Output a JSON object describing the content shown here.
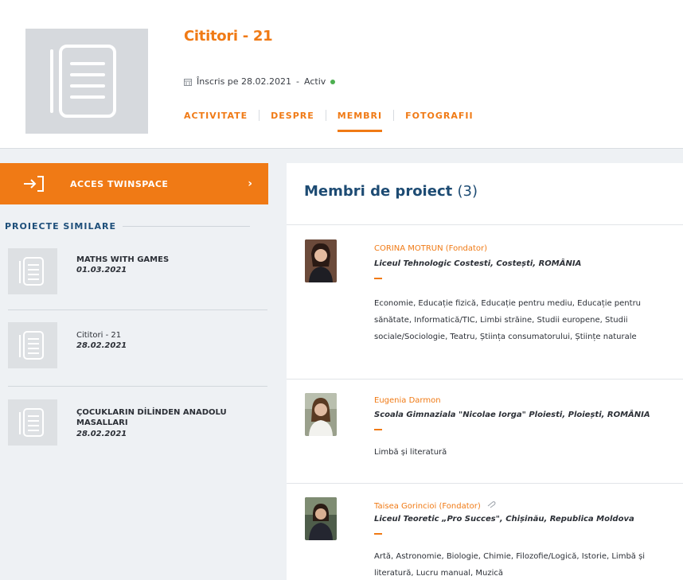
{
  "header": {
    "title": "Cititori - 21",
    "enrolled": "Înscris pe 28.02.2021",
    "separator": "-",
    "status": "Activ",
    "tabs": [
      {
        "label": "ACTIVITATE"
      },
      {
        "label": "DESPRE"
      },
      {
        "label": "MEMBRI"
      },
      {
        "label": "FOTOGRAFII"
      }
    ],
    "active_tab": "MEMBRI"
  },
  "sidebar": {
    "twinspace_label": "ACCES TWINSPACE",
    "chevron": "›",
    "similar_title": "PROIECTE SIMILARE",
    "similar_projects": [
      {
        "name": "MATHS WITH GAMES",
        "date": "01.03.2021"
      },
      {
        "name": "Cititori - 21",
        "date": "28.02.2021"
      },
      {
        "name": "ÇOCUKLARIN DİLİNDEN ANADOLU MASALLARI",
        "date": "28.02.2021"
      }
    ]
  },
  "members_panel": {
    "title": "Membri de proiect",
    "count": "(3)",
    "members": [
      {
        "name": "CORINA MOTRUN (Fondator)",
        "school": "Liceul Tehnologic Costesti, Costești, ROMÂNIA",
        "subjects": "Economie, Educație fizică, Educație pentru mediu, Educație pentru sănătate, Informatică/TIC, Limbi străine, Studii europene, Studii sociale/Sociologie, Teatru, Știința consumatorului, Științe naturale"
      },
      {
        "name": "Eugenia Darmon",
        "school": "Scoala Gimnaziala \"Nicolae Iorga\" Ploiesti, Ploiești, ROMÂNIA",
        "subjects": "Limbă și literatură"
      },
      {
        "name": "Taisea Gorincioi (Fondator)",
        "school": "Liceul Teoretic „Pro Succes\", Chișinău, Republica Moldova",
        "subjects": "Artă, Astronomie, Biologie, Chimie, Filozofie/Logică, Istorie, Limbă și literatură, Lucru manual, Muzică"
      }
    ]
  },
  "colors": {
    "accent": "#f07a15",
    "heading_blue": "#1d4b73",
    "status_green": "#4caf50"
  },
  "icons": {
    "project": "document-icon",
    "calendar": "calendar-icon",
    "twinspace": "login-arrow-icon",
    "paperclip": "paperclip-icon"
  }
}
